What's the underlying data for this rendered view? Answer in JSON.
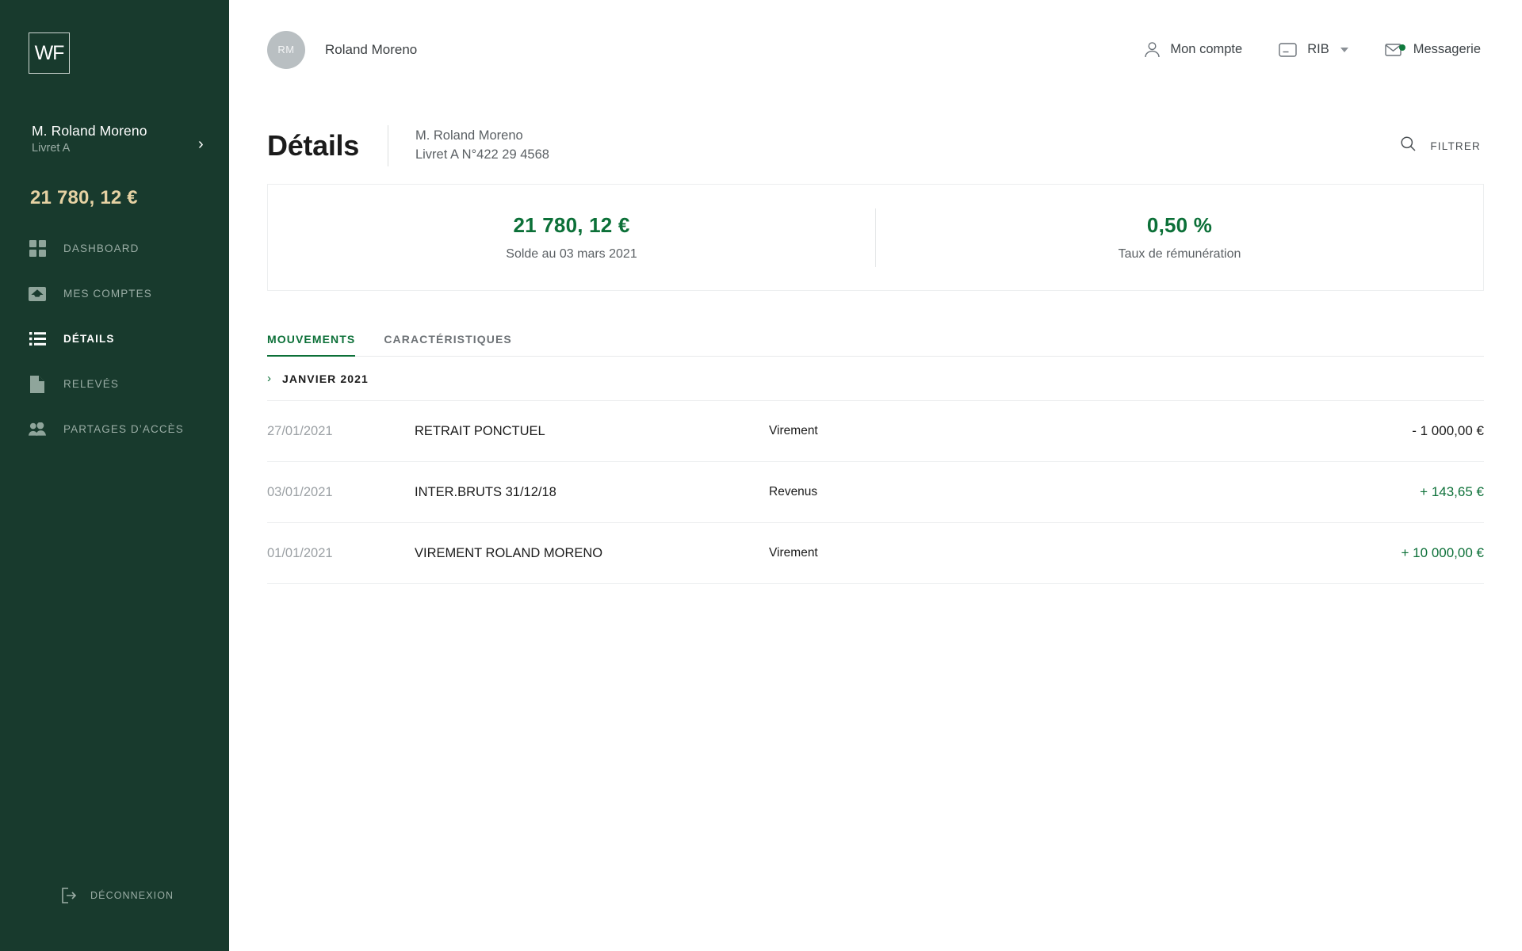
{
  "colors": {
    "sidebar_bg": "#183a2d",
    "accent_green": "#0c7038",
    "gold": "#e6d2a3",
    "muted": "#9aada5"
  },
  "sidebar": {
    "logo_text": "WF",
    "account": {
      "name": "M. Roland Moreno",
      "type": "Livret A",
      "balance": "21 780, 12 €",
      "chevron": "›"
    },
    "items": [
      {
        "label": "DASHBOARD",
        "icon": "grid-icon",
        "active": false
      },
      {
        "label": "MES COMPTES",
        "icon": "inbox-icon",
        "active": false
      },
      {
        "label": "DÉTAILS",
        "icon": "list-icon",
        "active": true
      },
      {
        "label": "RELEVÉS",
        "icon": "document-icon",
        "active": false
      },
      {
        "label": "PARTAGES D’ACCÈS",
        "icon": "people-icon",
        "active": false
      }
    ],
    "logout": {
      "label": "DÉCONNEXION",
      "icon": "logout-icon"
    }
  },
  "topbar": {
    "avatar_initials": "RM",
    "user_name": "Roland Moreno",
    "nav": [
      {
        "label": "Mon compte",
        "icon": "person-icon",
        "has_caret": false,
        "has_dot": false
      },
      {
        "label": "RIB",
        "icon": "card-icon",
        "has_caret": true,
        "has_dot": false
      },
      {
        "label": "Messagerie",
        "icon": "envelope-icon",
        "has_caret": false,
        "has_dot": true
      }
    ]
  },
  "page": {
    "title": "Détails",
    "subtitle_line1": "M. Roland Moreno",
    "subtitle_line2": "Livret A N°422 29 4568",
    "filter": {
      "label": "FILTRER",
      "icon": "search-icon"
    }
  },
  "summary": [
    {
      "value": "21 780, 12 €",
      "label": "Solde au 03 mars 2021"
    },
    {
      "value": "0,50 %",
      "label": "Taux de rémunération"
    }
  ],
  "tabs": [
    {
      "label": "MOUVEMENTS",
      "active": true
    },
    {
      "label": "CARACTÉRISTIQUES",
      "active": false
    }
  ],
  "transactions": {
    "group_label": "JANVIER 2021",
    "group_chevron": "›",
    "rows": [
      {
        "date": "27/01/2021",
        "label": "RETRAIT PONCTUEL",
        "category": "Virement",
        "amount": "- 1 000,00 €",
        "sign": "neg"
      },
      {
        "date": "03/01/2021",
        "label": "INTER.BRUTS 31/12/18",
        "category": "Revenus",
        "amount": "+ 143,65 €",
        "sign": "pos"
      },
      {
        "date": "01/01/2021",
        "label": "VIREMENT ROLAND MORENO",
        "category": "Virement",
        "amount": "+ 10 000,00 €",
        "sign": "pos"
      }
    ]
  }
}
